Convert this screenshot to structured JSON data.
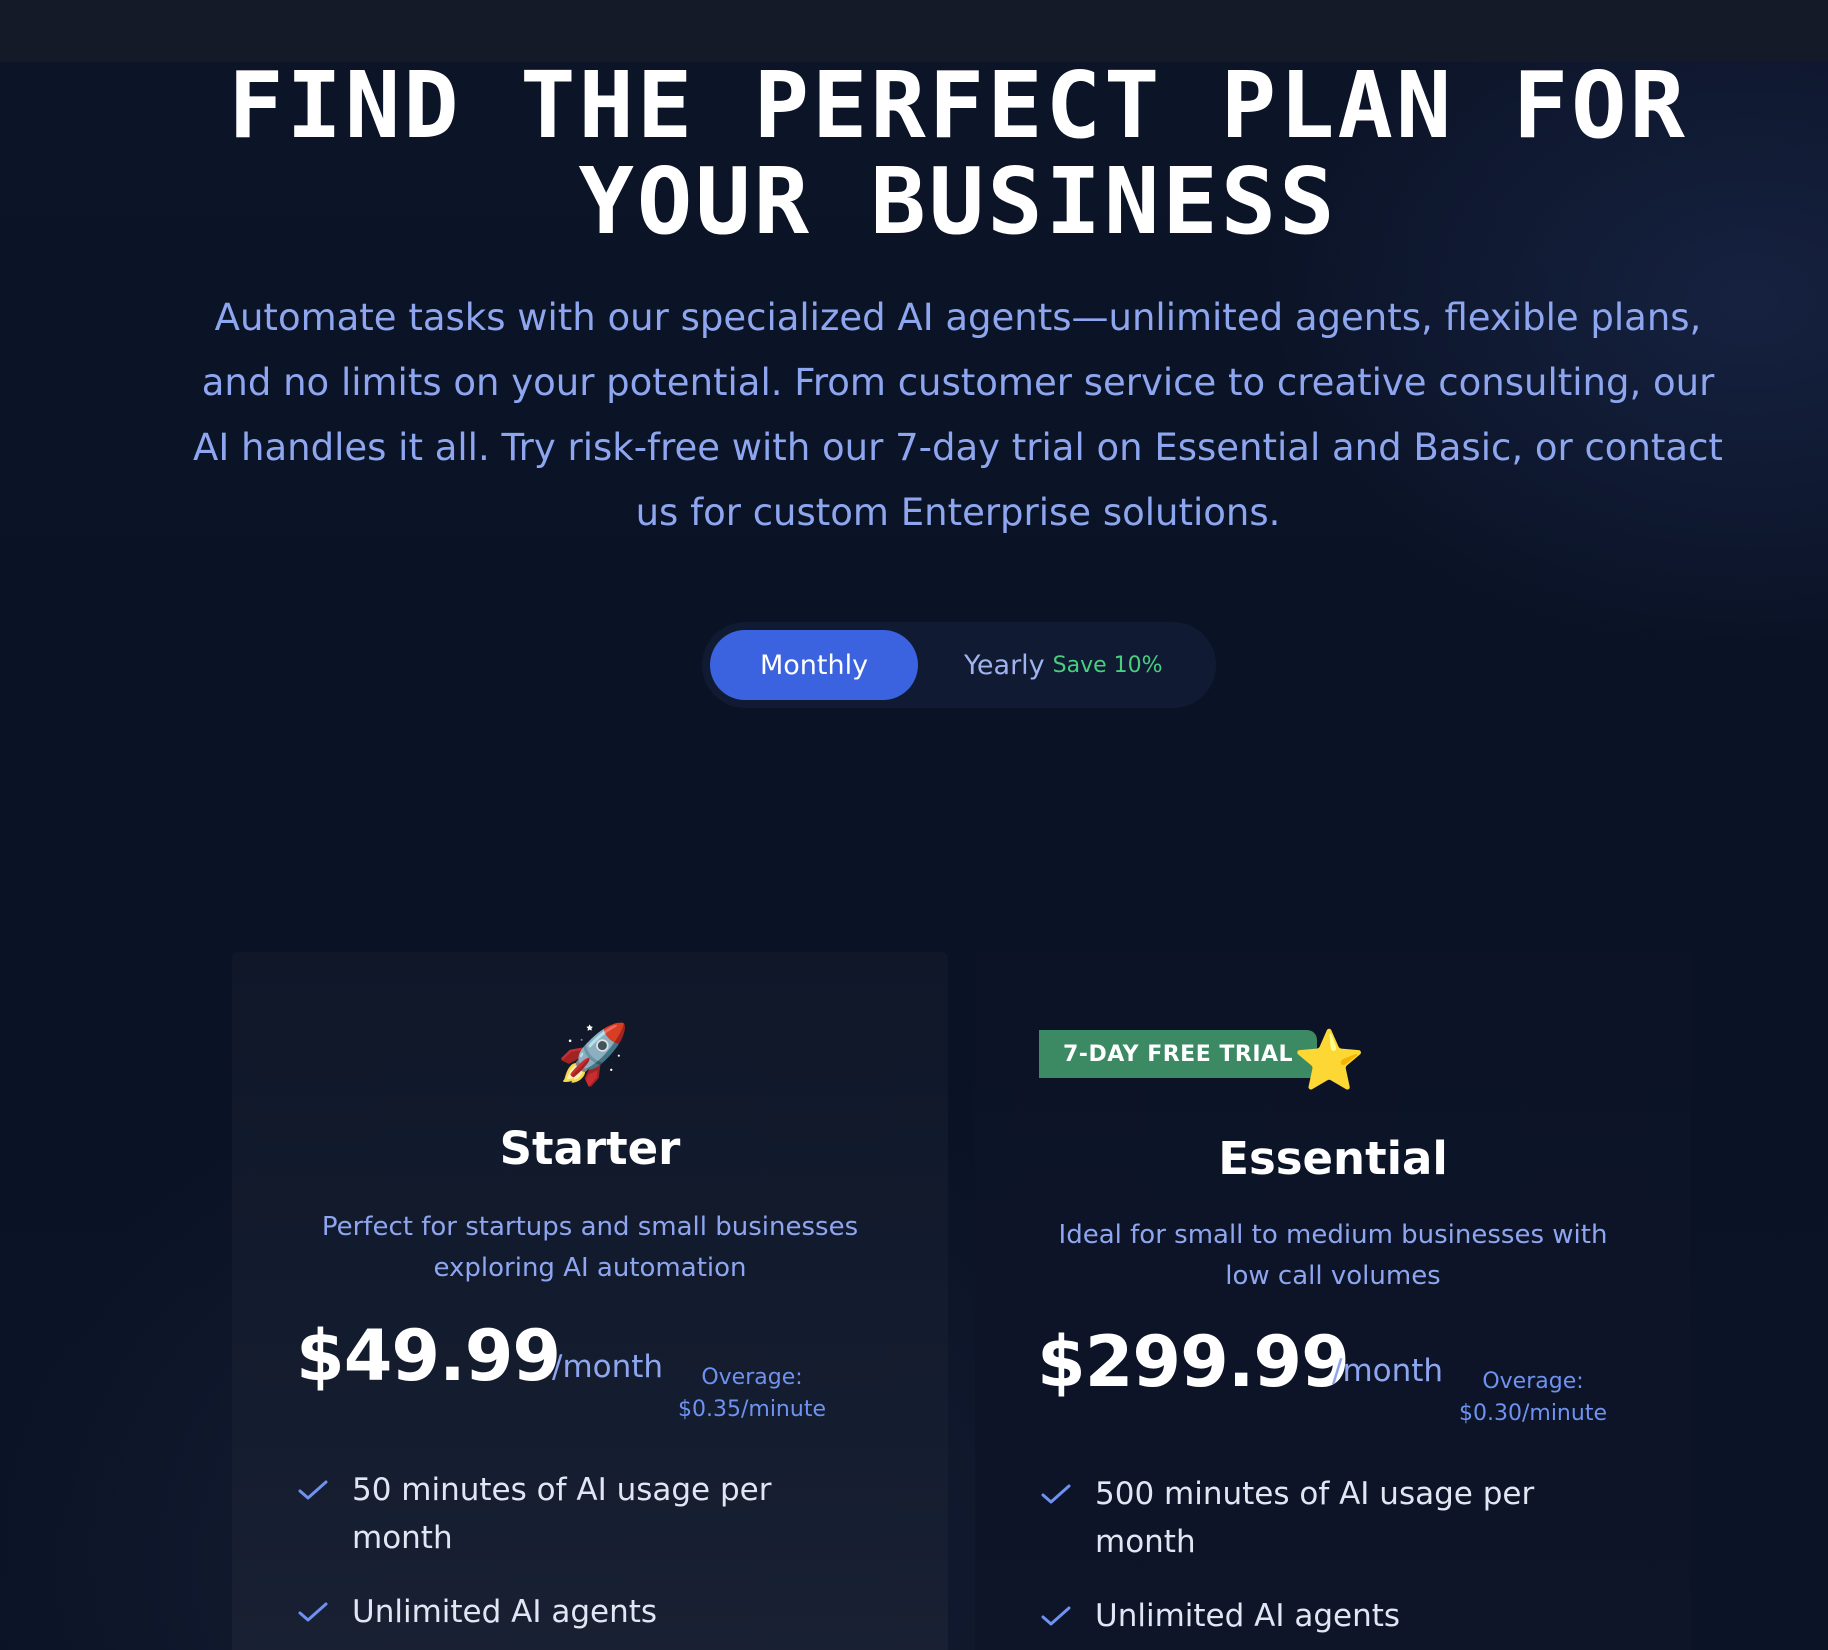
{
  "hero": {
    "title_line1": "FIND THE PERFECT PLAN FOR",
    "title_line2": "YOUR BUSINESS",
    "subtitle": "Automate tasks with our specialized AI agents—unlimited agents, flexible plans, and no limits on your potential. From customer service to creative consulting, our AI handles it all. Try risk-free with our 7-day trial on Essential and Basic, or contact us for custom Enterprise solutions."
  },
  "billing_toggle": {
    "monthly_label": "Monthly",
    "yearly_label": "Yearly",
    "yearly_save": "Save 10%",
    "selected": "Monthly"
  },
  "colors": {
    "accent": "#3b63e0",
    "save_green": "#46d07e",
    "trial_badge": "#3c8a63",
    "text_muted": "#8ea6f0"
  },
  "plans": [
    {
      "icon": "rocket-icon",
      "icon_glyph": "🚀",
      "name": "Starter",
      "description": "Perfect for startups and small businesses exploring AI automation",
      "price": "$49.99",
      "period": "/month",
      "overage_label": "Overage:",
      "overage_value": "$0.35/minute",
      "features": [
        "50 minutes of AI usage per month",
        "Unlimited AI agents"
      ]
    },
    {
      "badge": "7-DAY FREE TRIAL",
      "icon": "star-icon",
      "icon_glyph": "⭐",
      "name": "Essential",
      "description": "Ideal for small to medium businesses with low call volumes",
      "price": "$299.99",
      "period": "/month",
      "overage_label": "Overage:",
      "overage_value": "$0.30/minute",
      "features": [
        "500 minutes of AI usage per month",
        "Unlimited AI agents"
      ]
    }
  ]
}
